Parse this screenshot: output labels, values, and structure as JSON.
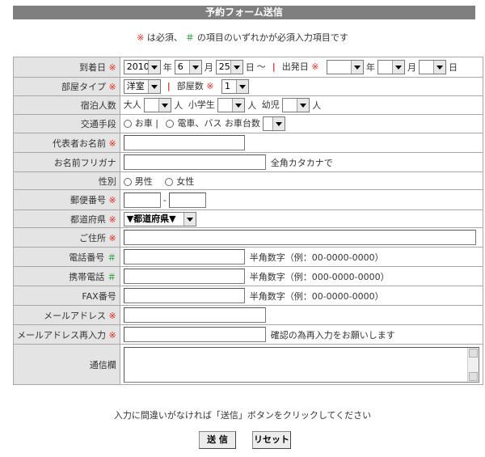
{
  "header": {
    "title": "予約フォーム送信"
  },
  "note": {
    "mark_required": "※",
    "text1": " は必須、 ",
    "mark_either": "＃",
    "text2": " の項目のいずれかが必須入力項目です"
  },
  "marks": {
    "required": "※",
    "either": "＃"
  },
  "rows": {
    "arrival": {
      "label": "到着日",
      "year": "2010",
      "month": "6",
      "day": "25",
      "year_unit": "年",
      "month_unit": "月",
      "day_unit": "日",
      "tilde": "～",
      "depart_label": "出発日",
      "depart_year_unit": "年",
      "depart_month_unit": "月",
      "depart_day_unit": "日"
    },
    "room": {
      "label": "部屋タイプ",
      "type": "洋室",
      "count_label": "部屋数",
      "count": "1"
    },
    "guests": {
      "label": "宿泊人数",
      "adult": "大人",
      "child": "小学生",
      "infant": "幼児",
      "unit": "人"
    },
    "transport": {
      "label": "交通手段",
      "car": "お車",
      "bar": "|",
      "train": "電車、バス",
      "car_count": "お車台数"
    },
    "name": {
      "label": "代表者お名前"
    },
    "kana": {
      "label": "お名前フリガナ",
      "hint": "全角カタカナで"
    },
    "gender": {
      "label": "性別",
      "male": "男性",
      "female": "女性"
    },
    "zip": {
      "label": "郵便番号",
      "dash": "-"
    },
    "pref": {
      "label": "都道府県",
      "value": "▼都道府県▼"
    },
    "address": {
      "label": "ご住所"
    },
    "tel": {
      "label": "電話番号",
      "hint": "半角数字（例：00-0000-0000）"
    },
    "mobile": {
      "label": "携帯電話",
      "hint": "半角数字（例：000-0000-0000）"
    },
    "fax": {
      "label": "FAX番号",
      "hint": "半角数字（例：00-0000-0000）"
    },
    "email": {
      "label": "メールアドレス"
    },
    "email2": {
      "label": "メールアドレス再入力",
      "hint": "確認の為再入力をお願いします"
    },
    "message": {
      "label": "通信欄"
    }
  },
  "footer": {
    "note": "入力に間違いがなければ「送信」ボタンをクリックしてください",
    "submit": "送 信",
    "reset": "リセット"
  },
  "colors": {
    "required": "#e8291f",
    "either": "#1a9a2a",
    "header_bg": "#7f7f7f",
    "label_bg": "#e4e4e4"
  }
}
